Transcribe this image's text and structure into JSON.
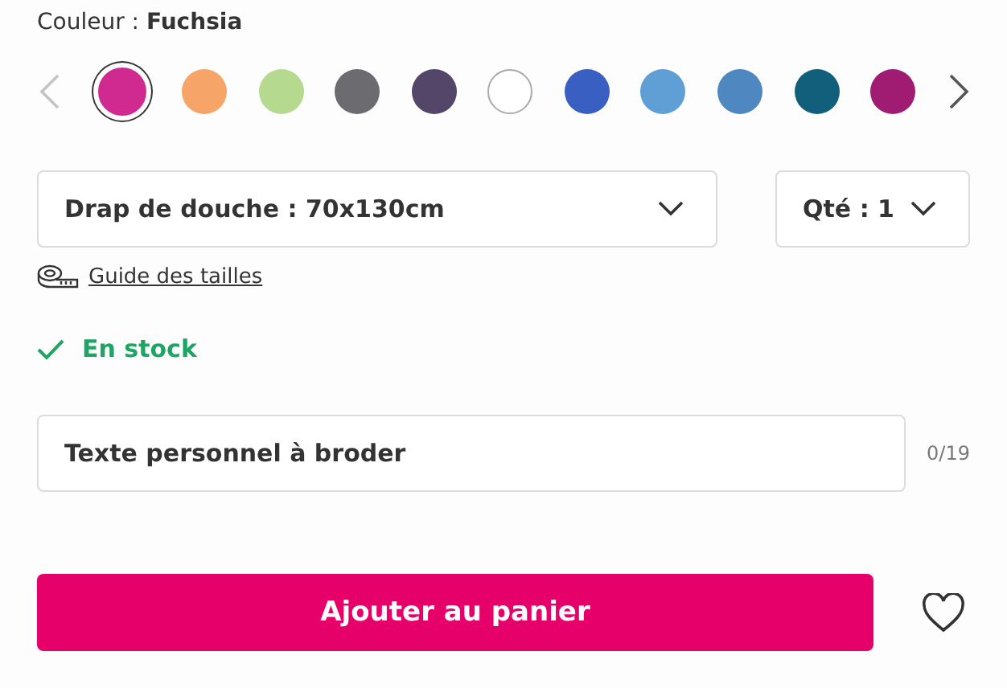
{
  "color_picker": {
    "label": "Couleur :",
    "value": "Fuchsia",
    "prev": {
      "disabled": true
    },
    "next": {
      "disabled": false
    },
    "swatches": [
      {
        "color": "#d02a91",
        "selected": true
      },
      {
        "color": "#f6a467",
        "selected": false
      },
      {
        "color": "#b5d98f",
        "selected": false
      },
      {
        "color": "#6c6c70",
        "selected": false
      },
      {
        "color": "#534668",
        "selected": false
      },
      {
        "color": "#ffffff",
        "selected": false
      },
      {
        "color": "#3a5fc2",
        "selected": false
      },
      {
        "color": "#609fd5",
        "selected": false
      },
      {
        "color": "#4f88c0",
        "selected": false
      },
      {
        "color": "#125f7b",
        "selected": false
      },
      {
        "color": "#a01b72",
        "selected": false
      }
    ]
  },
  "size_select": {
    "value": "Drap de douche : 70x130cm"
  },
  "quantity_select": {
    "value": "Qté : 1"
  },
  "size_guide": {
    "label": "Guide des tailles"
  },
  "stock": {
    "in_stock": true,
    "label": "En stock"
  },
  "personalization": {
    "placeholder": "Texte personnel à broder",
    "counter": "0/19"
  },
  "add_to_cart": {
    "label": "Ajouter au panier"
  },
  "favorite": {
    "on": false
  }
}
